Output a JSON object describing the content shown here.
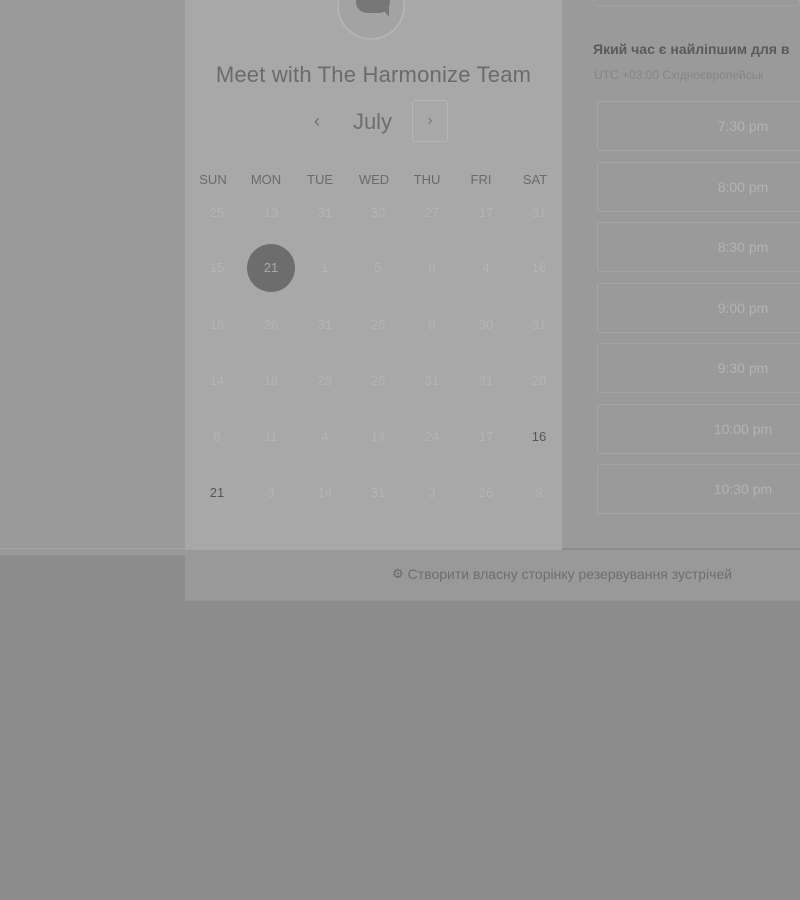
{
  "header": {
    "title": "Meet with The Harmonize Team",
    "month": "July",
    "prev_icon": "‹",
    "next_icon": "›"
  },
  "calendar": {
    "weekdays": [
      "SUN",
      "MON",
      "TUE",
      "WED",
      "THU",
      "FRI",
      "SAT"
    ],
    "weeks": [
      [
        "25",
        "13",
        "31",
        "30",
        "27",
        "17",
        "31"
      ],
      [
        "15",
        "21",
        "1",
        "5",
        "8",
        "4",
        "16"
      ],
      [
        "18",
        "26",
        "31",
        "26",
        "9",
        "30",
        "31"
      ],
      [
        "14",
        "18",
        "28",
        "26",
        "31",
        "31",
        "20"
      ],
      [
        "8",
        "11",
        "4",
        "14",
        "24",
        "17",
        "16"
      ],
      [
        "21",
        "3",
        "14",
        "31",
        "3",
        "26",
        "9"
      ]
    ],
    "selected_day": "21"
  },
  "times": {
    "heading": "Який час є найліпшим для в",
    "timezone": "UTC +03:00 Східноєвропейськ",
    "slots": [
      "7:30 pm",
      "8:00 pm",
      "8:30 pm",
      "9:00 pm",
      "9:30 pm",
      "10:00 pm",
      "10:30 pm"
    ]
  },
  "footer": {
    "link": "Створити власну сторінку резервування зустрічей",
    "icon": "hubspot-sprocket-icon"
  }
}
